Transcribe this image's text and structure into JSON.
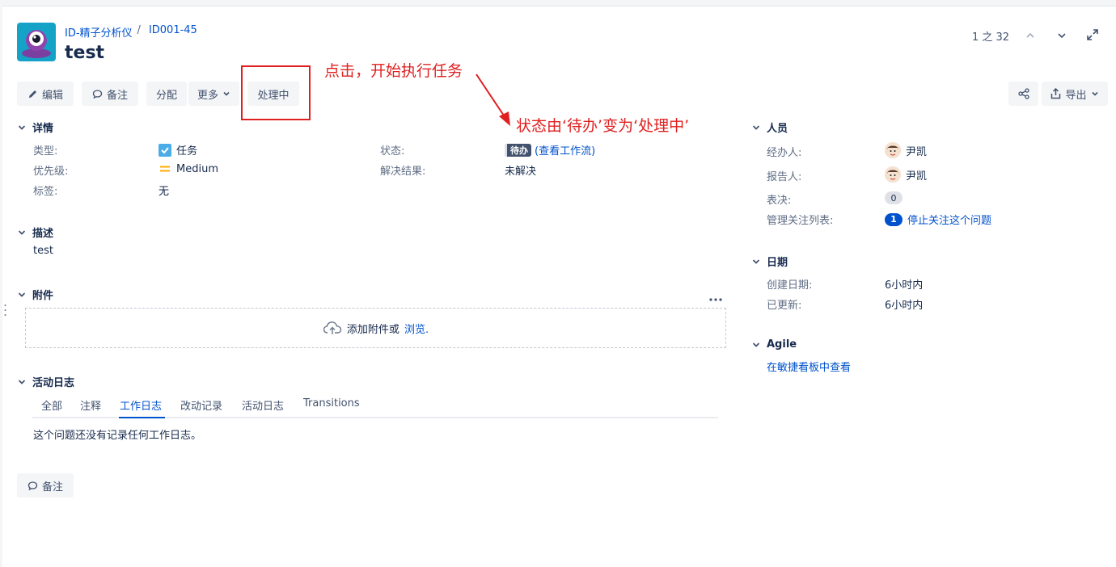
{
  "header": {
    "project_name": "ID-精子分析仪",
    "separator": "/",
    "issue_key": "ID001-45",
    "title": "test",
    "pager": "1 之 32"
  },
  "toolbar": {
    "edit": "编辑",
    "comment": "备注",
    "assign": "分配",
    "more": "更多",
    "in_progress": "处理中",
    "export": "导出"
  },
  "annotations": {
    "click_hint": "点击，开始执行任务",
    "status_hint": "状态由‘待办’变为‘处理中’"
  },
  "details": {
    "heading": "详情",
    "type_label": "类型:",
    "type_value": "任务",
    "priority_label": "优先级:",
    "priority_value": "Medium",
    "labels_label": "标签:",
    "labels_value": "无",
    "status_label": "状态:",
    "status_value": "待办",
    "status_link": "(查看工作流)",
    "resolution_label": "解决结果:",
    "resolution_value": "未解决"
  },
  "description": {
    "heading": "描述",
    "text": "test"
  },
  "attachments": {
    "heading": "附件",
    "drop_text": "添加附件或",
    "browse": "浏览."
  },
  "activity": {
    "heading": "活动日志",
    "tabs": [
      "全部",
      "注释",
      "工作日志",
      "改动记录",
      "活动日志",
      "Transitions"
    ],
    "active_tab": "工作日志",
    "empty_text": "这个问题还没有记录任何工作日志。",
    "comment_button": "备注"
  },
  "people": {
    "heading": "人员",
    "assignee_label": "经办人:",
    "assignee": "尹凯",
    "reporter_label": "报告人:",
    "reporter": "尹凯",
    "votes_label": "表决:",
    "votes": "0",
    "watchers_label": "管理关注列表:",
    "watchers_count": "1",
    "watch_link": "停止关注这个问题"
  },
  "dates": {
    "heading": "日期",
    "created_label": "创建日期:",
    "created": "6小时内",
    "updated_label": "已更新:",
    "updated": "6小时内"
  },
  "agile": {
    "heading": "Agile",
    "link": "在敏捷看板中查看"
  },
  "colors": {
    "link": "#0052cc",
    "annotation": "#e02020",
    "button_bg": "#f4f5f7",
    "status_bg": "#42526e"
  }
}
